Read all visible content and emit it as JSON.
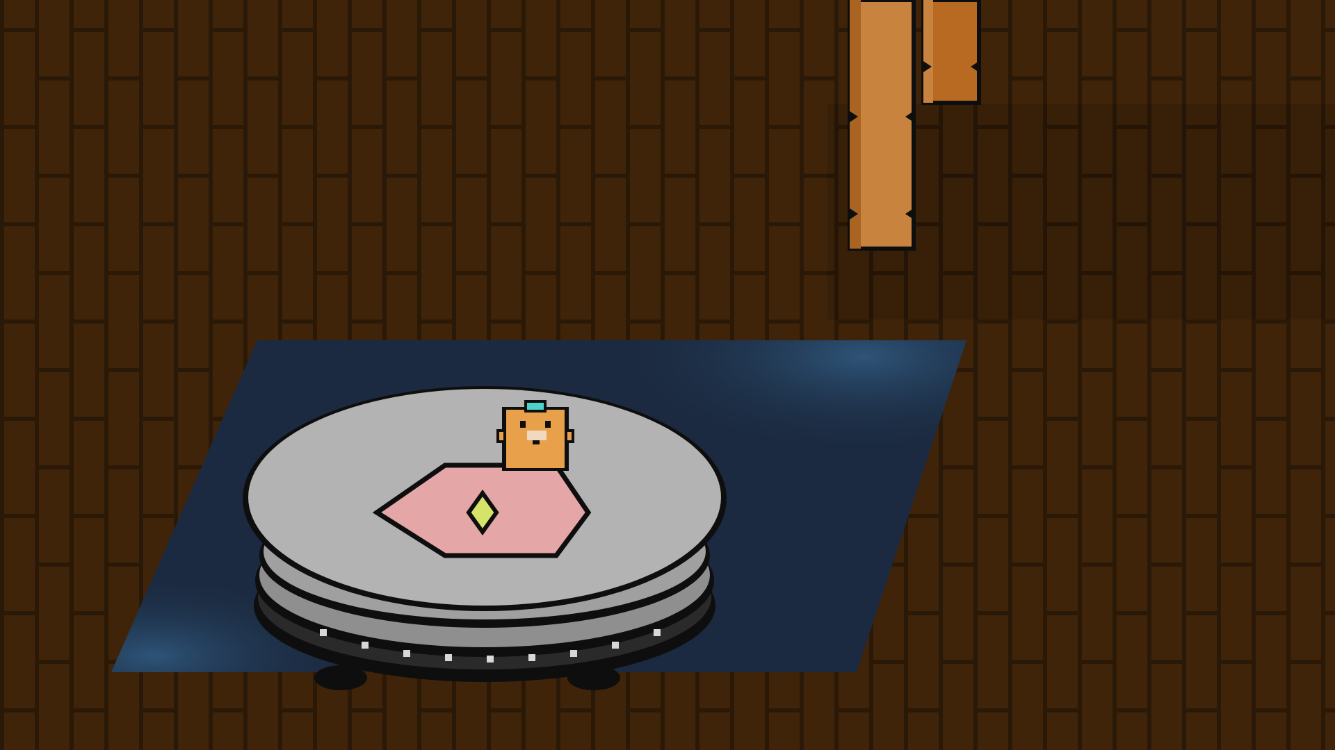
{
  "scene": {
    "description_labels": [],
    "colors": {
      "floor_base": "#3f240a",
      "floor_line": "#2a1808",
      "rug": "#1b2a40",
      "rug_highlight": "#2e5478",
      "robot_top": "#b3b3b3",
      "robot_side": "#8f8f8f",
      "robot_dark": "#2a2a2a",
      "robot_pad": "#e4a6a6",
      "button": "#d6e36a",
      "hamster_fur": "#e8a04a",
      "hamster_hat": "#4fd3c8",
      "table_leg": "#c8843e",
      "table_leg_dark": "#a86420",
      "outline": "#0e0e0e"
    },
    "sprites": [
      {
        "name": "hamster",
        "icon": "hamster-sprite-icon"
      },
      {
        "name": "robot-vacuum",
        "icon": "robot-vacuum-icon"
      },
      {
        "name": "table-leg-left",
        "icon": "wooden-leg-icon"
      },
      {
        "name": "table-leg-right",
        "icon": "wooden-leg-icon"
      },
      {
        "name": "rug",
        "icon": "rug-icon"
      }
    ]
  }
}
